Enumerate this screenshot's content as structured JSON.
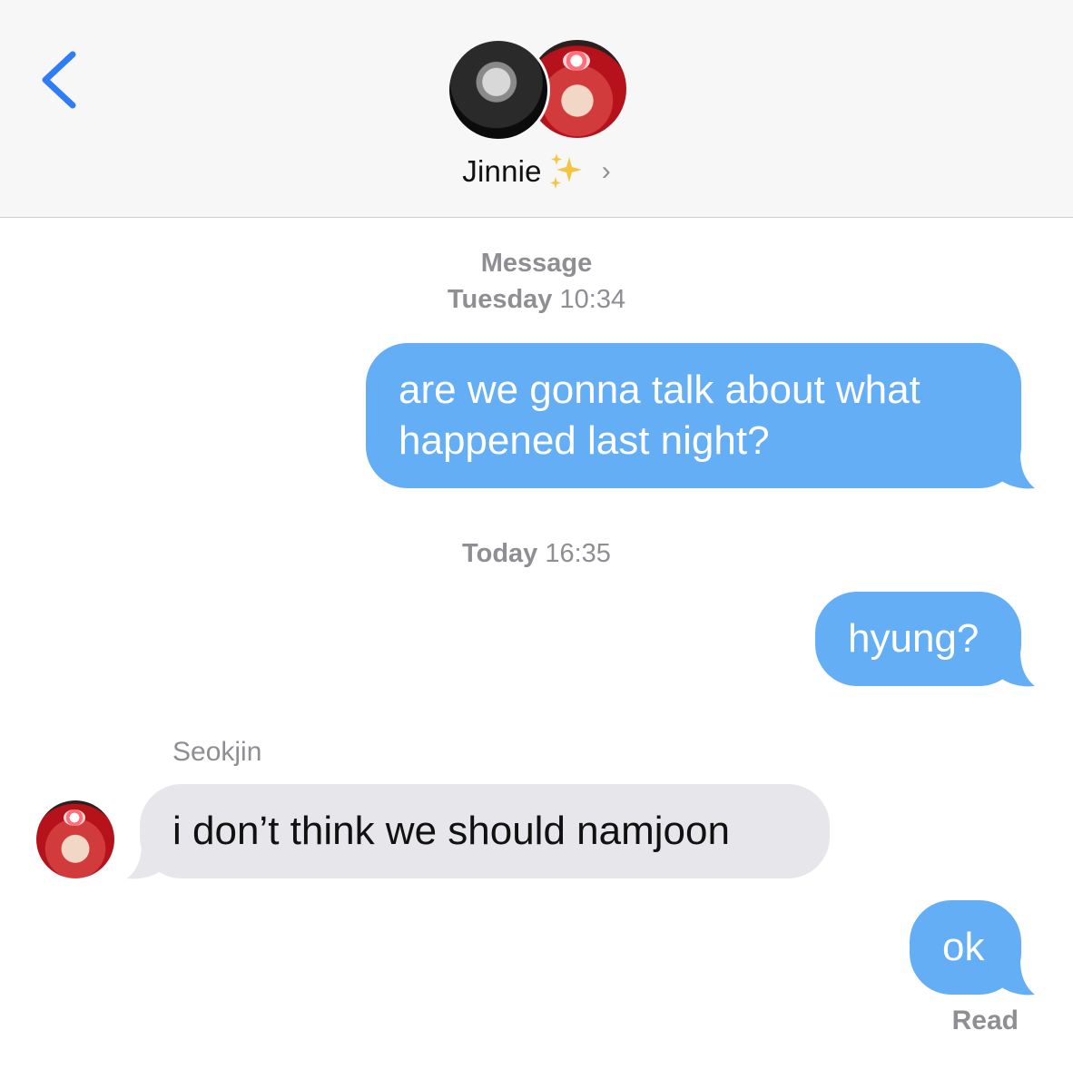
{
  "header": {
    "contact_name": "Jinnie",
    "contact_emoji": "sparkles-icon"
  },
  "thread": {
    "label_1_bold": "Message",
    "label_2_bold": "Tuesday",
    "label_2_time": "10:34",
    "label_3_bold": "Today",
    "label_3_time": "16:35",
    "messages": [
      {
        "direction": "outgoing",
        "line1": "are we gonna talk about what",
        "line2": "happened last night?"
      },
      {
        "direction": "outgoing",
        "text": "hyung?"
      },
      {
        "direction": "incoming",
        "sender": "Seokjin",
        "text": "i don’t think we should namjoon"
      },
      {
        "direction": "outgoing",
        "text": "ok"
      }
    ],
    "status": "Read"
  },
  "colors": {
    "outgoing_bubble": "#64aef5",
    "incoming_bubble": "#e6e6eb",
    "accent_blue": "#2f7cf6",
    "meta_gray": "#8e8e93"
  }
}
